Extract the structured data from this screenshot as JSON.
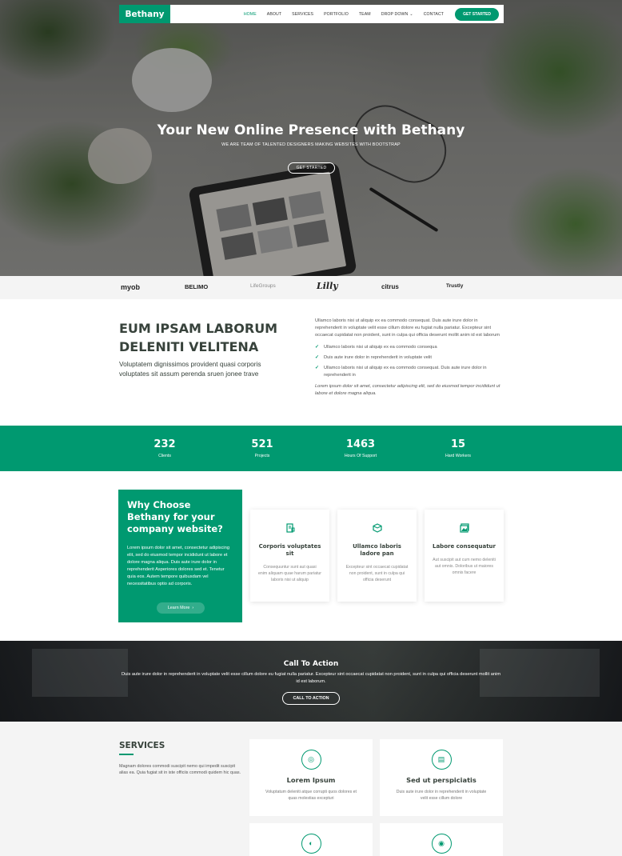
{
  "nav": {
    "logo": "Bethany",
    "items": [
      "HOME",
      "ABOUT",
      "SERVICES",
      "PORTFOLIO",
      "TEAM",
      "DROP DOWN",
      "CONTACT"
    ],
    "cta": "GET STARTED"
  },
  "hero": {
    "title": "Your New Online Presence with Bethany",
    "subtitle": "WE ARE TEAM OF TALENTED DESIGNERS MAKING WEBSITES WITH BOOTSTRAP",
    "button": "GET STARTED"
  },
  "clients": [
    "myob",
    "BELIMO",
    "LifeGroups",
    "Lilly",
    "citrus",
    "Trustly"
  ],
  "about": {
    "title": "EUM IPSAM LABORUM DELENITI VELITENA",
    "lead": "Voluptatem dignissimos provident quasi corporis voluptates sit assum perenda sruen jonee trave",
    "paragraph": "Ullamco laboris nisi ut aliquip ex ea commodo consequat. Duis aute irure dolor in reprehenderit in voluptate velit esse cillum dolore eu fugiat nulla pariatur. Excepteur sint occaecat cupidatat non proident, sunt in culpa qui officia deserunt mollit anim id est laborum",
    "list": [
      "Ullamco laboris nisi ut aliquip ex ea commodo consequa",
      "Duis aute irure dolor in reprehenderit in voluptate velit",
      "Ullamco laboris nisi ut aliquip ex ea commodo consequat. Duis aute irure dolor in reprehenderit in"
    ],
    "italic": "Lorem ipsum dolor sit amet, consectetur adipiscing elit, sed do eiusmod tempor incididunt ut labore et dolore magna aliqua."
  },
  "counts": [
    {
      "value": "232",
      "label": "Clients"
    },
    {
      "value": "521",
      "label": "Projects"
    },
    {
      "value": "1463",
      "label": "Hours Of Support"
    },
    {
      "value": "15",
      "label": "Hard Workers"
    }
  ],
  "why": {
    "title": "Why Choose Bethany for your company website?",
    "text": "Lorem ipsum dolor sit amet, consectetur adipiscing elit, sed do eiusmod tempor incididunt ut labore et dolore magna aliqua. Duis aute irure dolor in reprehenderit Asperiores dolores sed et. Tenetur quia eos. Autem tempore quibusdam vel necessitatibus optio ad corporis.",
    "button": "Learn More",
    "boxes": [
      {
        "icon": "receipt-icon",
        "title": "Corporis voluptates sit",
        "text": "Consequuntur sunt aut quasi enim aliquam quae harum pariatur laboris nisi ut aliquip"
      },
      {
        "icon": "cube-icon",
        "title": "Ullamco laboris ladore pan",
        "text": "Excepteur sint occaecat cupidatat non proident, sunt in culpa qui officia deserunt"
      },
      {
        "icon": "images-icon",
        "title": "Labore consequatur",
        "text": "Aut suscipit aut cum nemo deleniti aut omnis. Doloribus ut maiores omnis facere"
      }
    ]
  },
  "cta": {
    "title": "Call To Action",
    "text": "Duis aute irure dolor in reprehenderit in voluptate velit esse cillum dolore eu fugiat nulla pariatur. Excepteur sint occaecat cupidatat non proident, sunt in culpa qui officia deserunt mollit anim id est laborum.",
    "button": "CALL TO ACTION"
  },
  "services": {
    "title": "SERVICES",
    "desc": "Magnam dolores commodi suscipit nemo qui impedit suscipit alias ea. Quia fugiat sit in iste officiis commodi quidem hic quas.",
    "cards": [
      {
        "icon": "dribbble-icon",
        "title": "Lorem Ipsum",
        "text": "Voluptatum deleniti atque corrupti quos dolores et quas molestias excepturi"
      },
      {
        "icon": "file-icon",
        "title": "Sed ut perspiciatis",
        "text": "Duis aute irure dolor in reprehenderit in voluptate velit esse cillum dolore"
      },
      {
        "icon": "speedometer-icon",
        "title": "",
        "text": ""
      },
      {
        "icon": "globe-icon",
        "title": "",
        "text": ""
      }
    ]
  },
  "colors": {
    "accent": "#009970",
    "heading": "#37423b"
  }
}
